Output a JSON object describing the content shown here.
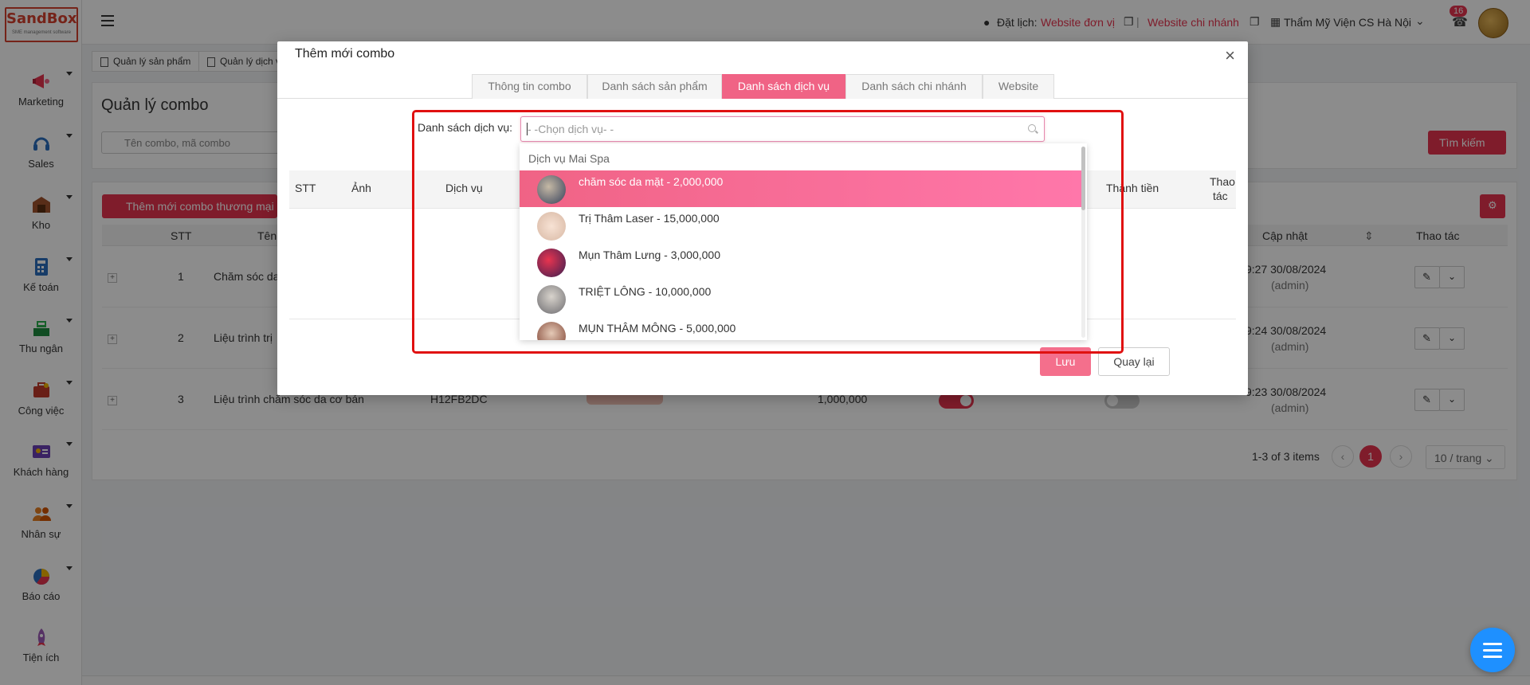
{
  "app": {
    "logo_text": "SandBox",
    "logo_sub": "SME management software"
  },
  "sidebar": {
    "items": [
      {
        "label": "Marketing",
        "icon": "megaphone-icon"
      },
      {
        "label": "Sales",
        "icon": "headset-icon"
      },
      {
        "label": "Kho",
        "icon": "warehouse-icon"
      },
      {
        "label": "Kế toán",
        "icon": "calculator-icon"
      },
      {
        "label": "Thu ngân",
        "icon": "cash-register-icon"
      },
      {
        "label": "Công việc",
        "icon": "briefcase-icon"
      },
      {
        "label": "Khách hàng",
        "icon": "id-card-icon"
      },
      {
        "label": "Nhân sự",
        "icon": "people-icon"
      },
      {
        "label": "Báo cáo",
        "icon": "pie-chart-icon"
      },
      {
        "label": "Tiện ích",
        "icon": "rocket-icon"
      }
    ]
  },
  "topbar": {
    "booking_label": "Đặt lịch:",
    "booking_link1": "Website đơn vị",
    "booking_link2": "Website chi nhánh",
    "branch": "Thẩm Mỹ Viện CS Hà Nội",
    "notif_count": "16"
  },
  "page_tabs": [
    "Quản lý sản phẩm",
    "Quản lý dịch v"
  ],
  "page": {
    "title": "Quản lý combo",
    "search_placeholder": "Tên combo, mã combo",
    "search_button": "Tìm kiếm",
    "add_button": "Thêm mới combo thương mại",
    "columns": {
      "stt": "STT",
      "name": "Tên",
      "updated": "Cập nhật",
      "actions": "Thao tác"
    },
    "rows": [
      {
        "stt": "1",
        "name": "Chăm sóc da",
        "code": "",
        "price": "",
        "updated": "9:27 30/08/2024",
        "by": "(admin)"
      },
      {
        "stt": "2",
        "name": "Liệu trình trị",
        "code": "",
        "price": "",
        "updated": "9:24 30/08/2024",
        "by": "(admin)"
      },
      {
        "stt": "3",
        "name": "Liệu trình chăm sóc da cơ bản",
        "code": "H12FB2DC",
        "price": "1,000,000",
        "updated": "9:23 30/08/2024",
        "by": "(admin)"
      }
    ],
    "pagination": {
      "summary": "1-3 of 3 items",
      "current": "1",
      "page_size": "10 / trang"
    }
  },
  "modal": {
    "title": "Thêm mới combo",
    "tabs": [
      "Thông tin combo",
      "Danh sách sản phẩm",
      "Danh sách dịch vụ",
      "Danh sách chi nhánh",
      "Website"
    ],
    "active_tab": 2,
    "field_label": "Danh sách dịch vụ:",
    "select_placeholder": "- -Chọn dịch vụ- -",
    "table_columns": {
      "stt": "STT",
      "image": "Ảnh",
      "service": "Dịch vụ",
      "total": "Thành tiền",
      "actions_1": "Thao",
      "actions_2": "tác"
    },
    "save_button": "Lưu",
    "back_button": "Quay lại",
    "dropdown": {
      "group": "Dịch vụ Mai Spa",
      "items": [
        {
          "label": "chăm sóc da mặt - 2,000,000",
          "highlighted": true
        },
        {
          "label": "Trị Thâm Laser - 15,000,000",
          "highlighted": false
        },
        {
          "label": "Mụn Thâm Lưng - 3,000,000",
          "highlighted": false
        },
        {
          "label": "TRIỆT LÔNG - 10,000,000",
          "highlighted": false
        },
        {
          "label": "MỤN THÂM MÔNG - 5,000,000",
          "highlighted": false
        }
      ]
    }
  },
  "colors": {
    "accent": "#e8344f",
    "active_tab": "#f06385",
    "highlight_box": "#e01010",
    "fab": "#1e90ff"
  }
}
